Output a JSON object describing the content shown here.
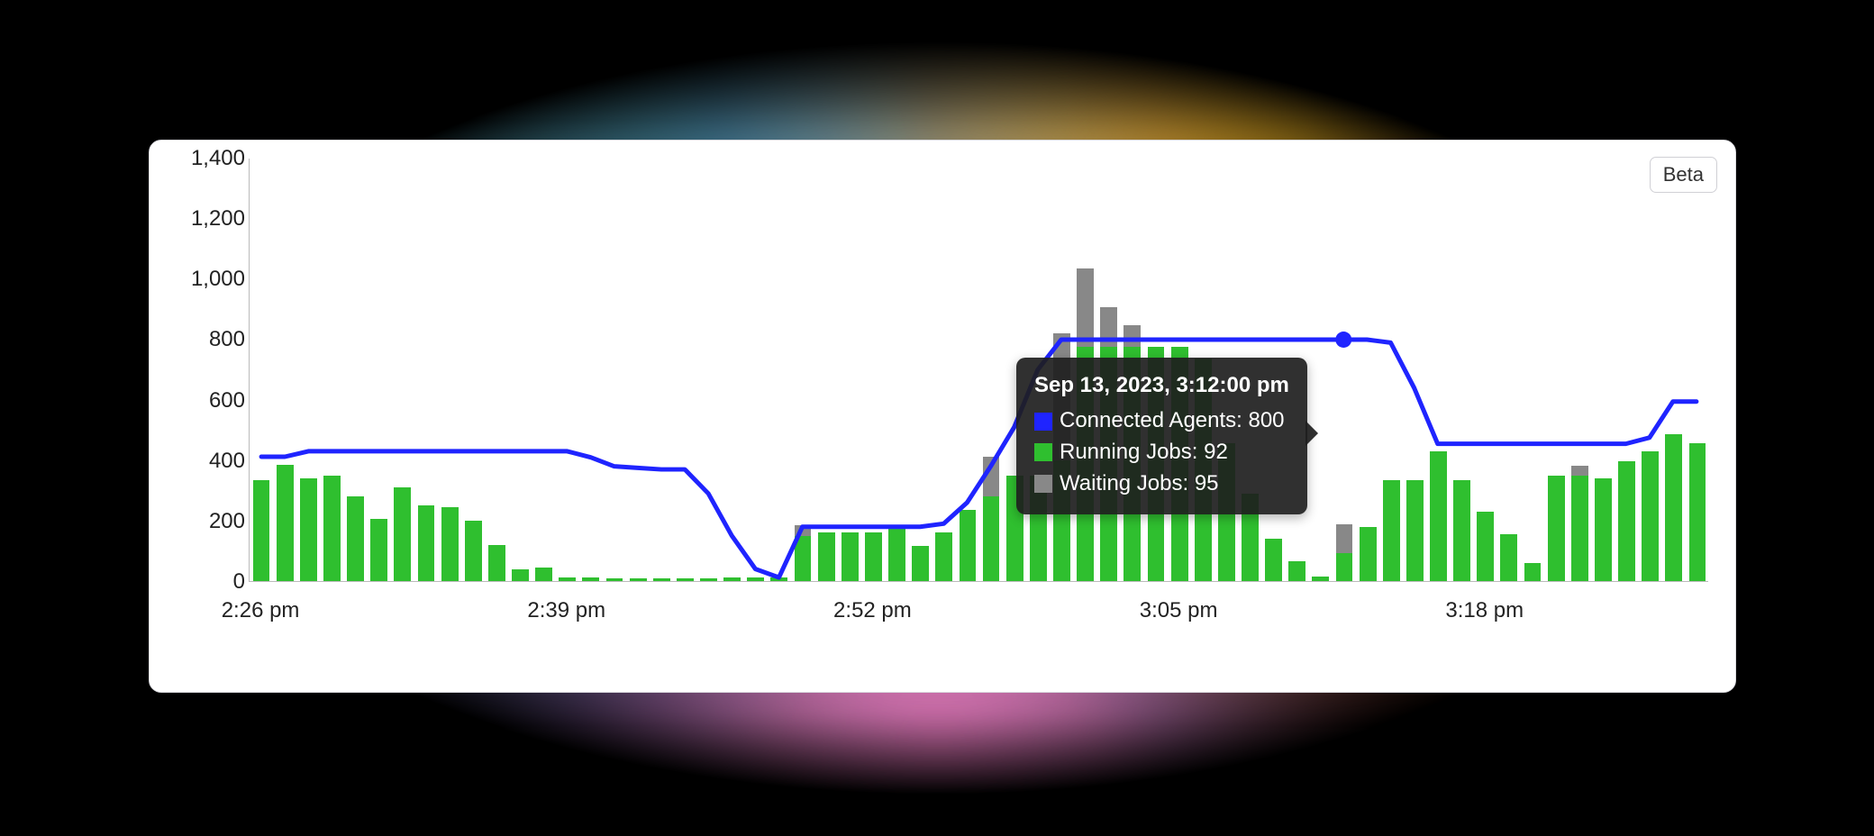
{
  "badge": {
    "label": "Beta"
  },
  "tooltip": {
    "title": "Sep 13, 2023, 3:12:00 pm",
    "rows": [
      {
        "label": "Connected Agents: 800",
        "color": "blue"
      },
      {
        "label": "Running Jobs: 92",
        "color": "green"
      },
      {
        "label": "Waiting Jobs: 95",
        "color": "gray"
      }
    ]
  },
  "chart_data": {
    "type": "bar",
    "ylim": [
      0,
      1400
    ],
    "yticks": [
      0,
      200,
      400,
      600,
      800,
      1000,
      1200,
      1400
    ],
    "xticks": [
      "2:26 pm",
      "2:39 pm",
      "2:52 pm",
      "3:05 pm",
      "3:18 pm"
    ],
    "xtick_indices": [
      0,
      13,
      26,
      39,
      52
    ],
    "hover_index": 46,
    "series": [
      {
        "name": "Running Jobs",
        "kind": "bar-stack",
        "color": "#2fbf2f",
        "values": [
          335,
          385,
          340,
          350,
          280,
          205,
          310,
          250,
          245,
          200,
          120,
          40,
          45,
          12,
          12,
          10,
          10,
          10,
          10,
          10,
          12,
          12,
          12,
          150,
          160,
          160,
          160,
          180,
          115,
          160,
          235,
          280,
          350,
          350,
          400,
          775,
          775,
          775,
          775,
          775,
          735,
          455,
          290,
          140,
          65,
          15,
          92,
          180,
          335,
          335,
          430,
          335,
          230,
          155,
          60,
          350,
          350,
          340,
          395,
          430,
          485,
          455
        ]
      },
      {
        "name": "Waiting Jobs",
        "kind": "bar-stack",
        "color": "#888888",
        "values": [
          0,
          0,
          0,
          0,
          0,
          0,
          0,
          0,
          0,
          0,
          0,
          0,
          0,
          0,
          0,
          0,
          0,
          0,
          0,
          0,
          0,
          0,
          0,
          35,
          0,
          0,
          0,
          0,
          0,
          0,
          0,
          130,
          0,
          0,
          420,
          260,
          130,
          70,
          0,
          0,
          0,
          0,
          0,
          0,
          0,
          0,
          95,
          0,
          0,
          0,
          0,
          0,
          0,
          0,
          0,
          0,
          30,
          0,
          0,
          0,
          0,
          0
        ]
      },
      {
        "name": "Connected Agents",
        "kind": "line",
        "color": "#1f24ff",
        "values": [
          412,
          412,
          430,
          430,
          430,
          430,
          430,
          430,
          430,
          430,
          430,
          430,
          430,
          430,
          410,
          380,
          375,
          370,
          370,
          290,
          150,
          40,
          12,
          180,
          180,
          180,
          180,
          180,
          180,
          190,
          260,
          380,
          510,
          700,
          800,
          800,
          800,
          800,
          800,
          800,
          800,
          800,
          800,
          800,
          800,
          800,
          800,
          800,
          790,
          640,
          455,
          455,
          455,
          455,
          455,
          455,
          455,
          455,
          455,
          475,
          595,
          595
        ]
      }
    ]
  }
}
